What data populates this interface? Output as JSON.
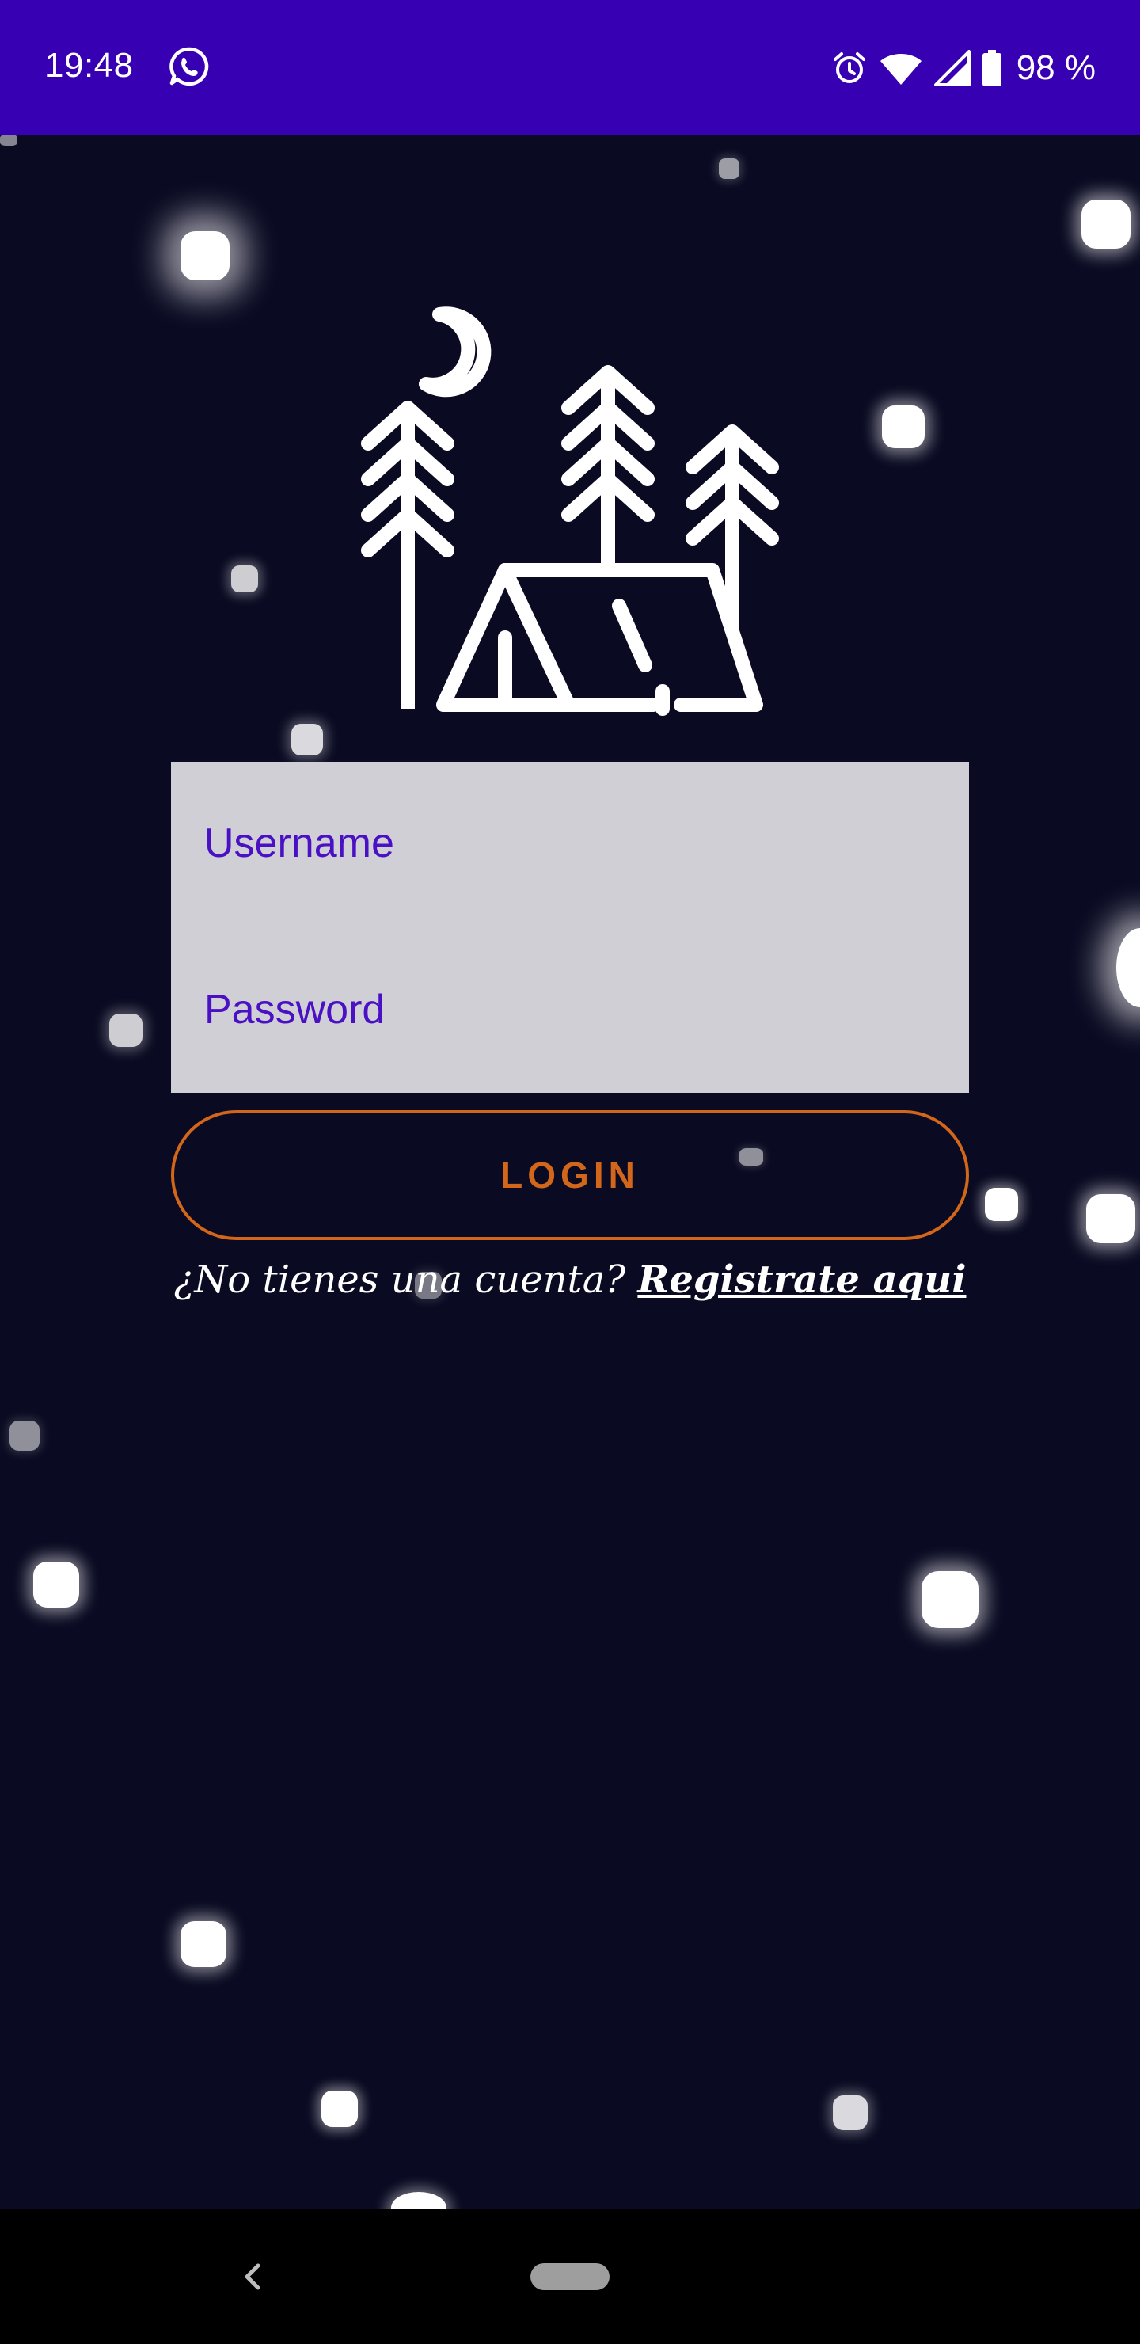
{
  "status_bar": {
    "time": "19:48",
    "battery": "98 %",
    "icons": [
      "whatsapp-icon",
      "alarm-icon",
      "wifi-icon",
      "signal-icon",
      "battery-icon"
    ],
    "color": "#3700b3"
  },
  "logo": {
    "icon": "camping-tent-moon-trees-icon"
  },
  "login_form": {
    "username_placeholder": "Username",
    "password_placeholder": "Password",
    "login_label": "LOGIN",
    "accent_color": "#d2661a",
    "field_text_color": "#3f00c8"
  },
  "register": {
    "prompt": "¿No tienes una cuenta? ",
    "link": "Registrate aqui"
  },
  "nav_bar": {
    "icons": [
      "back-icon",
      "home-pill-icon"
    ]
  },
  "background_color": "#0a0a22"
}
